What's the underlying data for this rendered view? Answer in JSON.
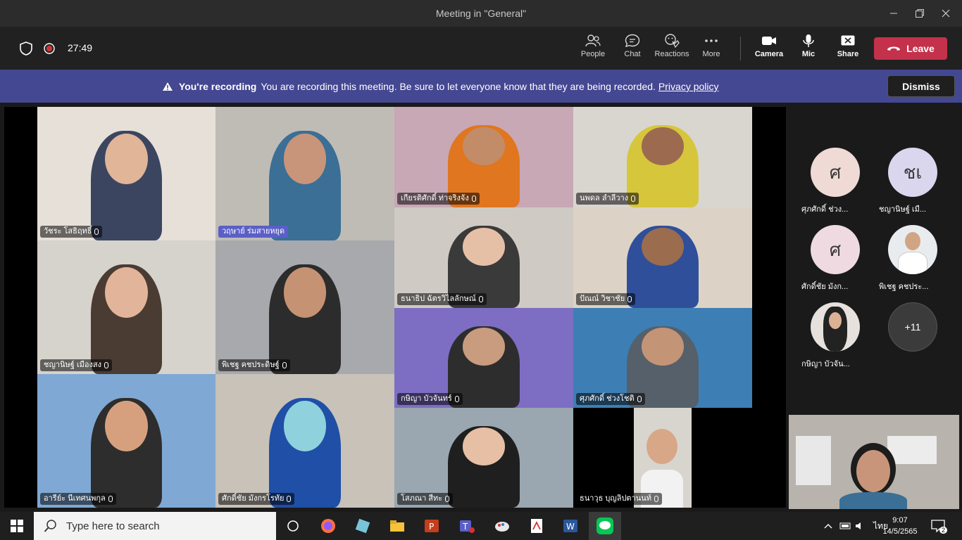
{
  "window": {
    "title": "Meeting in \"General\""
  },
  "toolbar": {
    "timer": "27:49",
    "people": "People",
    "chat": "Chat",
    "reactions": "Reactions",
    "more": "More",
    "camera": "Camera",
    "mic": "Mic",
    "share": "Share",
    "leave": "Leave"
  },
  "banner": {
    "title": "You're recording",
    "message": "You are recording this meeting. Be sure to let everyone know that they are being recorded.",
    "link": "Privacy policy",
    "dismiss": "Dismiss"
  },
  "participants": [
    {
      "name": "วัชระ โสธิฤทธิ์"
    },
    {
      "name": "วฤษาย์ ร่มสายหยุด"
    },
    {
      "name": "เกียรติศักดิ์ ท่าจริงจัง"
    },
    {
      "name": "นพดล ลำลีวาง"
    },
    {
      "name": "ธนาธิป ฉัตรวิไลลักษณ์"
    },
    {
      "name": "ปัณณ์ วิชาชัย"
    },
    {
      "name": "ชญานิษฐ์ เมืองสง"
    },
    {
      "name": "พิเชฐ คชประดิษฐ์"
    },
    {
      "name": "กษิญา บัวจันทร์"
    },
    {
      "name": "ศุภศักดิ์ ช่วงโชติ"
    },
    {
      "name": "อารีย์ะ นีเทศนพกุล"
    },
    {
      "name": "ศักดิ์ชัย มังกรโรทัย"
    },
    {
      "name": "โสภณา สีทะ"
    },
    {
      "name": "ธนาวุธ บุญลิปตานนท์"
    }
  ],
  "sidebar": [
    {
      "initial": "ศ",
      "name": "ศุภศักดิ์ ช่วง...",
      "color": "#efdad5"
    },
    {
      "initial": "ชเ",
      "name": "ชญานิษฐ์ เมื...",
      "color": "#dad6ee"
    },
    {
      "initial": "ศ",
      "name": "ศักดิ์ชัย มังก...",
      "color": "#efdae2"
    },
    {
      "initial": "",
      "name": "พิเชฐ คชประ...",
      "color": "#e9ecef"
    },
    {
      "initial": "",
      "name": "กษิญา บัวจัน...",
      "color": "#e6e1dc"
    },
    {
      "initial": "+11",
      "name": "",
      "color": "#3b3b3b"
    }
  ],
  "taskbar": {
    "search_placeholder": "Type here to search",
    "lang": "ไทย",
    "time": "9:07",
    "date": "14/5/2565",
    "notifications": "2"
  }
}
